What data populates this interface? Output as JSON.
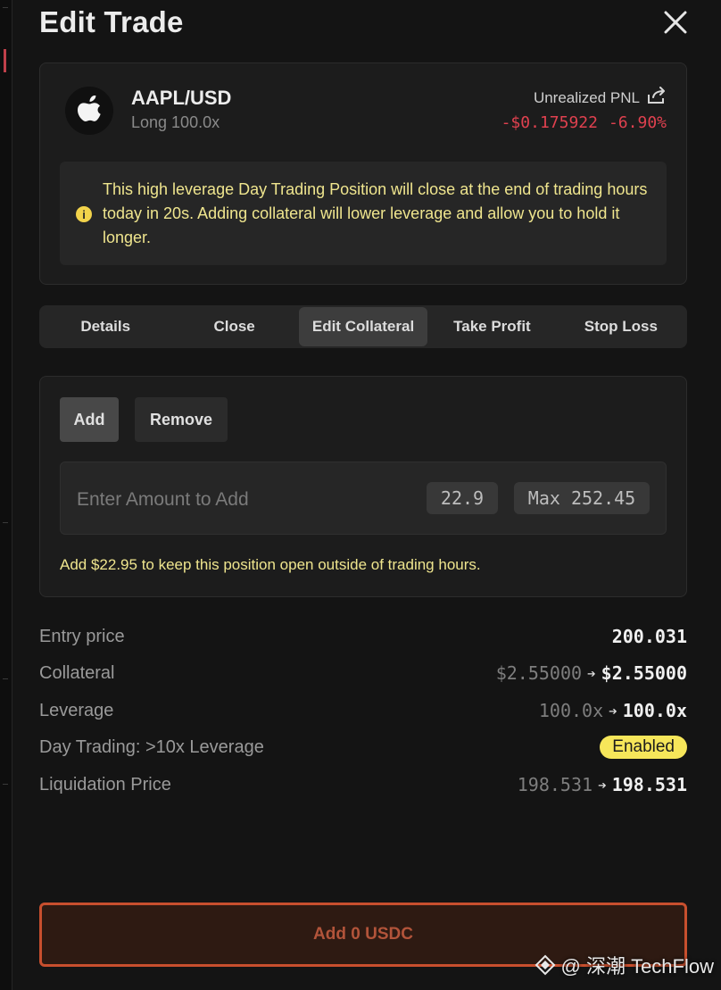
{
  "modal": {
    "title": "Edit Trade"
  },
  "trade": {
    "pair": "AAPL/USD",
    "position": "Long 100.0x",
    "pnl_label": "Unrealized PNL",
    "pnl_value": "-$0.175922",
    "pnl_percent": "-6.90%",
    "warning": "This high leverage Day Trading Position will close at the end of trading hours today in 20s. Adding collateral will lower leverage and allow you to hold it longer."
  },
  "tabs": [
    {
      "label": "Details",
      "active": false
    },
    {
      "label": "Close",
      "active": false
    },
    {
      "label": "Edit Collateral",
      "active": true
    },
    {
      "label": "Take Profit",
      "active": false
    },
    {
      "label": "Stop Loss",
      "active": false
    }
  ],
  "collateral": {
    "add_label": "Add",
    "remove_label": "Remove",
    "mode": "Add",
    "amount_placeholder": "Enter Amount to Add",
    "amount_value": "",
    "suggest_chip": "22.9",
    "max_chip": "Max 252.45",
    "hint": "Add $22.95 to keep this position open outside of trading hours."
  },
  "details": {
    "entry_label": "Entry price",
    "entry_value": "200.031",
    "collateral_label": "Collateral",
    "collateral_from": "$2.55000",
    "collateral_to": "$2.55000",
    "leverage_label": "Leverage",
    "leverage_from": "100.0x",
    "leverage_to": "100.0x",
    "daytrading_label": "Day Trading: >10x Leverage",
    "daytrading_status": "Enabled",
    "liq_label": "Liquidation Price",
    "liq_from": "198.531",
    "liq_to": "198.531"
  },
  "submit": {
    "label": "Add 0 USDC"
  },
  "watermark": {
    "text": "@ 深潮 TechFlow"
  },
  "colors": {
    "background": "#141414",
    "card": "#1c1c1c",
    "negative": "#e0414f",
    "warning_text": "#efe58e",
    "badge": "#f6e65a",
    "submit_border": "#c84f2e"
  },
  "icons": {
    "close": "close-icon",
    "asset": "apple-logo-icon",
    "share": "share-icon",
    "warning": "info-icon",
    "arrow": "arrow-right-icon",
    "watermark": "diamond-logo-icon"
  }
}
